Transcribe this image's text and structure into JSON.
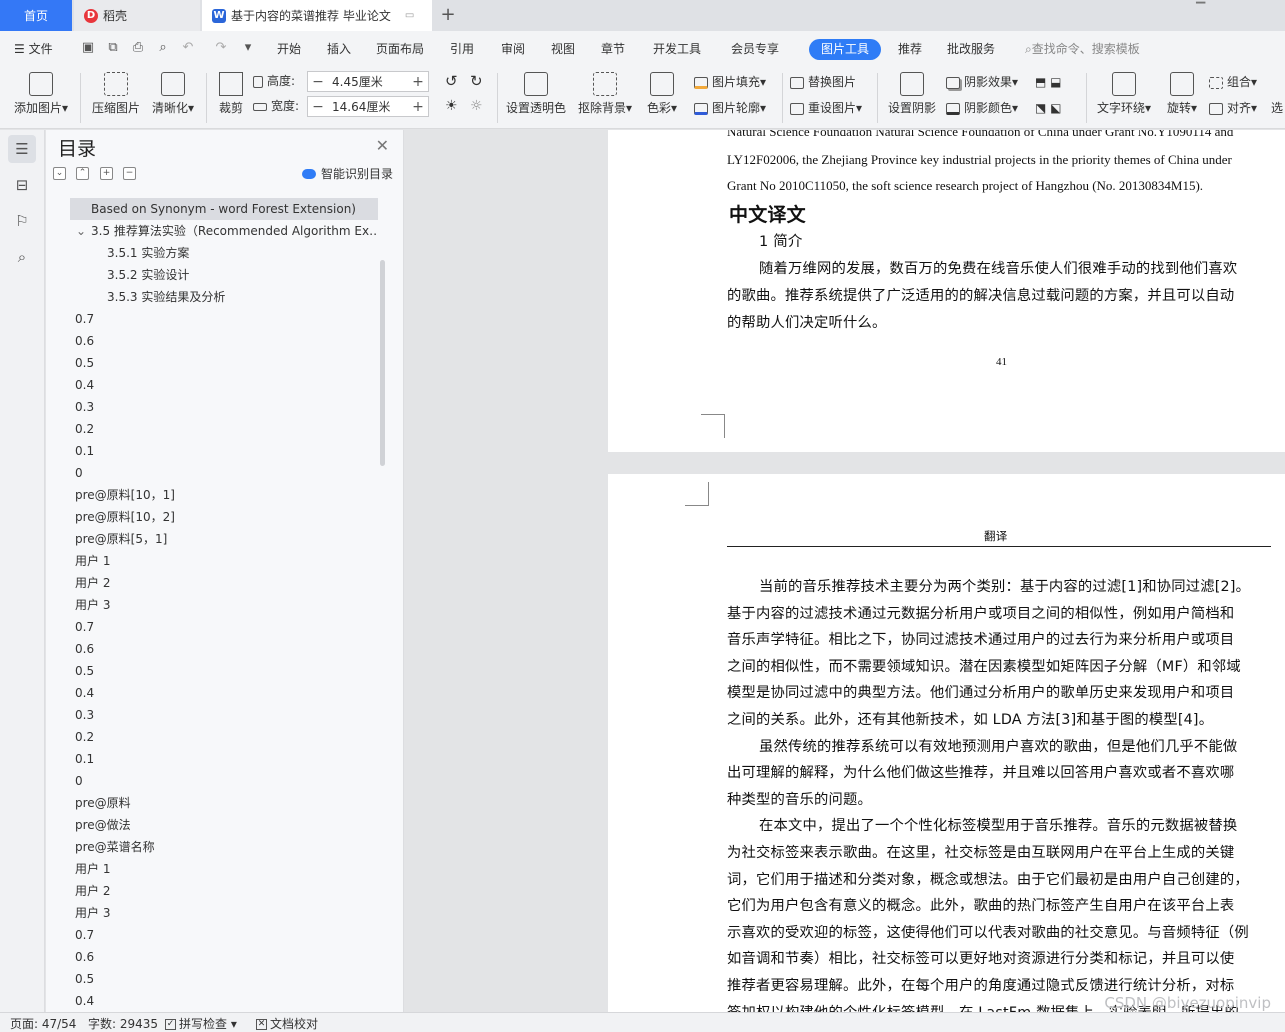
{
  "tabs": {
    "home": "首页",
    "docer": "稻壳",
    "document": "基于内容的菜谱推荐 毕业论文"
  },
  "menu": {
    "file": "文件",
    "items": [
      "开始",
      "插入",
      "页面布局",
      "引用",
      "审阅",
      "视图",
      "章节",
      "开发工具",
      "会员专享"
    ],
    "active": "图片工具",
    "items_after": [
      "推荐",
      "批改服务"
    ],
    "search_placeholder": "查找命令、搜索模板"
  },
  "ribbon": {
    "add_picture": "添加图片",
    "compress": "压缩图片",
    "sharpen": "清晰化",
    "crop": "裁剪",
    "height_label": "高度:",
    "height_value": "4.45厘米",
    "width_label": "宽度:",
    "width_value": "14.64厘米",
    "set_transparent": "设置透明色",
    "remove_bg": "抠除背景",
    "color": "色彩",
    "pic_fill": "图片填充",
    "pic_outline": "图片轮廓",
    "replace_pic": "替换图片",
    "reset_pic": "重设图片",
    "set_shadow": "设置阴影",
    "shadow_effect": "阴影效果",
    "shadow_color": "阴影颜色",
    "text_wrap": "文字环绕",
    "rotate": "旋转",
    "group": "组合",
    "align": "对齐",
    "select": "选"
  },
  "toc": {
    "title": "目录",
    "smart_label": "智能识别目录",
    "items": [
      {
        "text": "Based on Synonym - word Forest Extension)",
        "level": 1,
        "selected": true
      },
      {
        "text": "3.5 推荐算法实验（Recommended Algorithm Ex…",
        "level": 1,
        "expanded": true
      },
      {
        "text": "3.5.1 实验方案",
        "level": 2
      },
      {
        "text": "3.5.2 实验设计",
        "level": 2
      },
      {
        "text": "3.5.3 实验结果及分析",
        "level": 2
      },
      {
        "text": "0.7",
        "level": 0
      },
      {
        "text": "0.6",
        "level": 0
      },
      {
        "text": "0.5",
        "level": 0
      },
      {
        "text": "0.4",
        "level": 0
      },
      {
        "text": "0.3",
        "level": 0
      },
      {
        "text": "0.2",
        "level": 0
      },
      {
        "text": "0.1",
        "level": 0
      },
      {
        "text": "0",
        "level": 0
      },
      {
        "text": "pre@原料[10，1]",
        "level": 0
      },
      {
        "text": "pre@原料[10，2]",
        "level": 0
      },
      {
        "text": "pre@原料[5，1]",
        "level": 0
      },
      {
        "text": "用户 1",
        "level": 0
      },
      {
        "text": "用户 2",
        "level": 0
      },
      {
        "text": "用户 3",
        "level": 0
      },
      {
        "text": "0.7",
        "level": 0
      },
      {
        "text": "0.6",
        "level": 0
      },
      {
        "text": "0.5",
        "level": 0
      },
      {
        "text": "0.4",
        "level": 0
      },
      {
        "text": "0.3",
        "level": 0
      },
      {
        "text": "0.2",
        "level": 0
      },
      {
        "text": "0.1",
        "level": 0
      },
      {
        "text": "0",
        "level": 0
      },
      {
        "text": "pre@原料",
        "level": 0
      },
      {
        "text": "pre@做法",
        "level": 0
      },
      {
        "text": "pre@菜谱名称",
        "level": 0
      },
      {
        "text": "用户 1",
        "level": 0
      },
      {
        "text": "用户 2",
        "level": 0
      },
      {
        "text": "用户 3",
        "level": 0
      },
      {
        "text": "0.7",
        "level": 0
      },
      {
        "text": "0.6",
        "level": 0
      },
      {
        "text": "0.5",
        "level": 0
      },
      {
        "text": "0.4",
        "level": 0
      }
    ]
  },
  "doc": {
    "page1": {
      "en_lines": [
        "Natural Science Foundation Natural Science Foundation of China under Grant No.Y1090114 and",
        "LY12F02006, the Zhejiang Province key industrial projects in the priority themes of China under",
        "Grant No 2010C11050, the soft science research project of Hangzhou (No. 20130834M15)."
      ],
      "heading": "中文译文",
      "subheading": "1  简介",
      "zh_lines": [
        "随着万维网的发展，数百万的免费在线音乐使人们很难手动的找到他们喜欢",
        "的歌曲。推荐系统提供了广泛适用的的解决信息过载问题的方案，并且可以自动",
        "的帮助人们决定听什么。"
      ],
      "page_number": "41"
    },
    "page2": {
      "header": "翻译",
      "lines": [
        "当前的音乐推荐技术主要分为两个类别：基于内容的过滤[1]和协同过滤[2]。",
        "基于内容的过滤技术通过元数据分析用户或项目之间的相似性，例如用户简档和",
        "音乐声学特征。相比之下，协同过滤技术通过用户的过去行为来分析用户或项目",
        "之间的相似性，而不需要领域知识。潜在因素模型如矩阵因子分解（MF）和邻域",
        "模型是协同过滤中的典型方法。他们通过分析用户的歌单历史来发现用户和项目",
        "之间的关系。此外，还有其他新技术，如 LDA 方法[3]和基于图的模型[4]。",
        "虽然传统的推荐系统可以有效地预测用户喜欢的歌曲，但是他们几乎不能做",
        "出可理解的解释，为什么他们做这些推荐，并且难以回答用户喜欢或者不喜欢哪",
        "种类型的音乐的问题。",
        "在本文中，提出了一个个性化标签模型用于音乐推荐。音乐的元数据被替换",
        "为社交标签来表示歌曲。在这里，社交标签是由互联网用户在平台上生成的关键",
        "词，它们用于描述和分类对象，概念或想法。由于它们最初是由用户自己创建的，",
        "它们为用户包含有意义的概念。此外，歌曲的热门标签产生自用户在该平台上表",
        "示喜欢的受欢迎的标签，这使得他们可以代表对歌曲的社交意见。与音频特征（例",
        "如音调和节奏）相比，社交标签可以更好地对资源进行分类和标记，并且可以使",
        "推荐者更容易理解。此外，在每个用户的角度通过隐式反馈进行统计分析，对标",
        "签加权以构建他的个性化标签模型。在 LastFm 数据集上，实验表明，所提出的"
      ],
      "indented_lines": [
        0,
        6,
        9
      ]
    }
  },
  "status": {
    "page": "页面: 47/54",
    "words": "字数: 29435",
    "spell": "拼写检查",
    "proof": "文档校对"
  },
  "watermark": "CSDN @biyezuopinvip",
  "colors": {
    "accent": "#2f7cf6",
    "home_tab": "#3478f6"
  }
}
